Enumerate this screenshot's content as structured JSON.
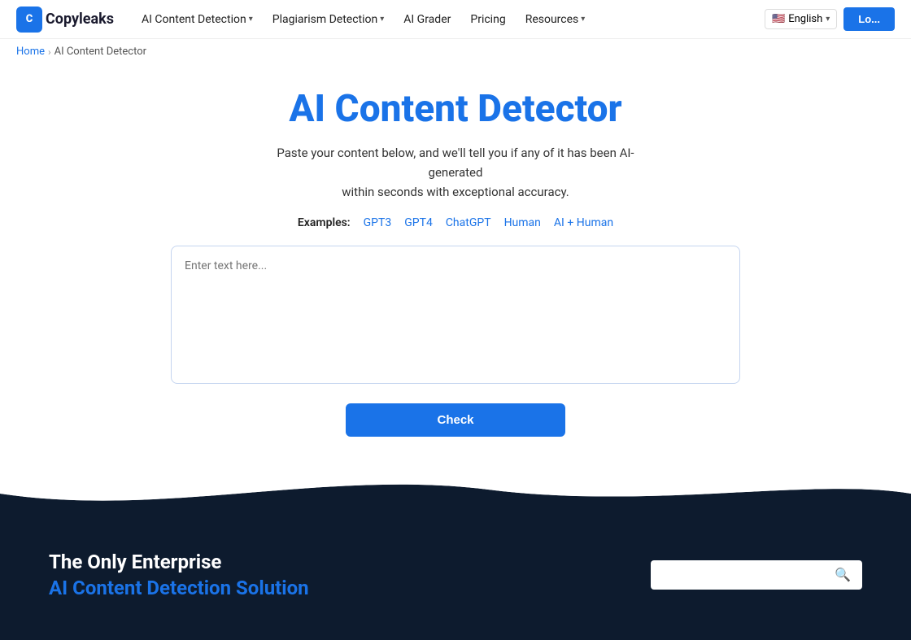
{
  "nav": {
    "logo_letter": "C",
    "logo_name": "Copyleaks",
    "items": [
      {
        "label": "AI Content Detection",
        "has_dropdown": true
      },
      {
        "label": "Plagiarism Detection",
        "has_dropdown": true
      },
      {
        "label": "AI Grader",
        "has_dropdown": false
      },
      {
        "label": "Pricing",
        "has_dropdown": false
      },
      {
        "label": "Resources",
        "has_dropdown": true
      }
    ],
    "lang_flag": "🇺🇸",
    "lang_label": "English",
    "login_label": "Lo..."
  },
  "breadcrumb": {
    "home_label": "Home",
    "separator": "›",
    "current": "AI Content Detector"
  },
  "hero": {
    "title": "AI Content Detector",
    "subtitle_line1": "Paste your content below, and we'll tell you if any of it has been AI-generated",
    "subtitle_line2": "within seconds with exceptional accuracy.",
    "examples_label": "Examples:",
    "examples": [
      {
        "label": "GPT3"
      },
      {
        "label": "GPT4"
      },
      {
        "label": "ChatGPT"
      },
      {
        "label": "Human"
      },
      {
        "label": "AI + Human"
      }
    ],
    "textarea_placeholder": "Enter text here...",
    "check_button_label": "Check"
  },
  "bottom": {
    "title_line1": "The Only Enterprise",
    "title_line2": "AI Content Detection Solution",
    "search_placeholder": ""
  }
}
